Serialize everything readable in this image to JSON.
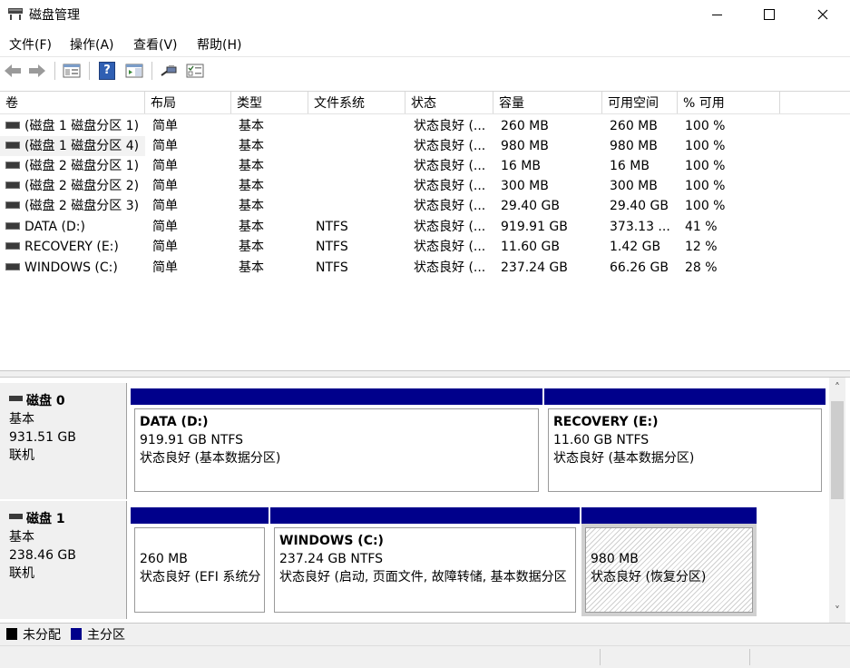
{
  "window": {
    "title": "磁盘管理",
    "controls": {
      "minimize": "—",
      "maximize": "☐",
      "close": "✕"
    }
  },
  "menu": {
    "items": [
      "文件(F)",
      "操作(A)",
      "查看(V)",
      "帮助(H)"
    ]
  },
  "toolbar": {
    "icons": [
      "back-arrow-icon",
      "forward-arrow-icon",
      "show-hide-console-tree-icon",
      "help-icon",
      "action-pane-icon",
      "connect-icon",
      "properties-icon"
    ],
    "help_glyph": "?"
  },
  "volume_list": {
    "columns": [
      "卷",
      "布局",
      "类型",
      "文件系统",
      "状态",
      "容量",
      "可用空间",
      "% 可用"
    ],
    "rows": [
      {
        "volume": "(磁盘 1 磁盘分区 1)",
        "layout": "简单",
        "type": "基本",
        "fs": "",
        "status": "状态良好 (...",
        "capacity": "260 MB",
        "free": "260 MB",
        "pct": "100 %"
      },
      {
        "volume": "(磁盘 1 磁盘分区 4)",
        "layout": "简单",
        "type": "基本",
        "fs": "",
        "status": "状态良好 (...",
        "capacity": "980 MB",
        "free": "980 MB",
        "pct": "100 %"
      },
      {
        "volume": "(磁盘 2 磁盘分区 1)",
        "layout": "简单",
        "type": "基本",
        "fs": "",
        "status": "状态良好 (...",
        "capacity": "16 MB",
        "free": "16 MB",
        "pct": "100 %"
      },
      {
        "volume": "(磁盘 2 磁盘分区 2)",
        "layout": "简单",
        "type": "基本",
        "fs": "",
        "status": "状态良好 (...",
        "capacity": "300 MB",
        "free": "300 MB",
        "pct": "100 %"
      },
      {
        "volume": "(磁盘 2 磁盘分区 3)",
        "layout": "简单",
        "type": "基本",
        "fs": "",
        "status": "状态良好 (...",
        "capacity": "29.40 GB",
        "free": "29.40 GB",
        "pct": "100 %"
      },
      {
        "volume": "DATA (D:)",
        "layout": "简单",
        "type": "基本",
        "fs": "NTFS",
        "status": "状态良好 (...",
        "capacity": "919.91 GB",
        "free": "373.13 ...",
        "pct": "41 %"
      },
      {
        "volume": "RECOVERY (E:)",
        "layout": "简单",
        "type": "基本",
        "fs": "NTFS",
        "status": "状态良好 (...",
        "capacity": "11.60 GB",
        "free": "1.42 GB",
        "pct": "12 %"
      },
      {
        "volume": "WINDOWS (C:)",
        "layout": "简单",
        "type": "基本",
        "fs": "NTFS",
        "status": "状态良好 (...",
        "capacity": "237.24 GB",
        "free": "66.26 GB",
        "pct": "28 %"
      }
    ]
  },
  "disks": [
    {
      "name": "磁盘 0",
      "kind": "基本",
      "size": "931.51 GB",
      "state": "联机",
      "partitions": [
        {
          "title": "DATA  (D:)",
          "size": "919.91 GB NTFS",
          "status": "状态良好 (基本数据分区)"
        },
        {
          "title": "RECOVERY  (E:)",
          "size": "11.60 GB NTFS",
          "status": "状态良好 (基本数据分区)"
        }
      ]
    },
    {
      "name": "磁盘 1",
      "kind": "基本",
      "size": "238.46 GB",
      "state": "联机",
      "partitions": [
        {
          "title": "",
          "size": "260 MB",
          "status": "状态良好 (EFI 系统分"
        },
        {
          "title": "WINDOWS  (C:)",
          "size": "237.24 GB NTFS",
          "status": "状态良好 (启动, 页面文件, 故障转储, 基本数据分区"
        },
        {
          "title": "",
          "size": "980 MB",
          "status": "状态良好 (恢复分区)"
        }
      ]
    }
  ],
  "legend": {
    "items": [
      {
        "label": "未分配",
        "color": "#000000"
      },
      {
        "label": "主分区",
        "color": "#00008b"
      }
    ]
  },
  "scrollbar": {
    "up": "˄",
    "down": "˅"
  },
  "colors": {
    "partition_bar": "#00008b",
    "unallocated": "#000000"
  }
}
